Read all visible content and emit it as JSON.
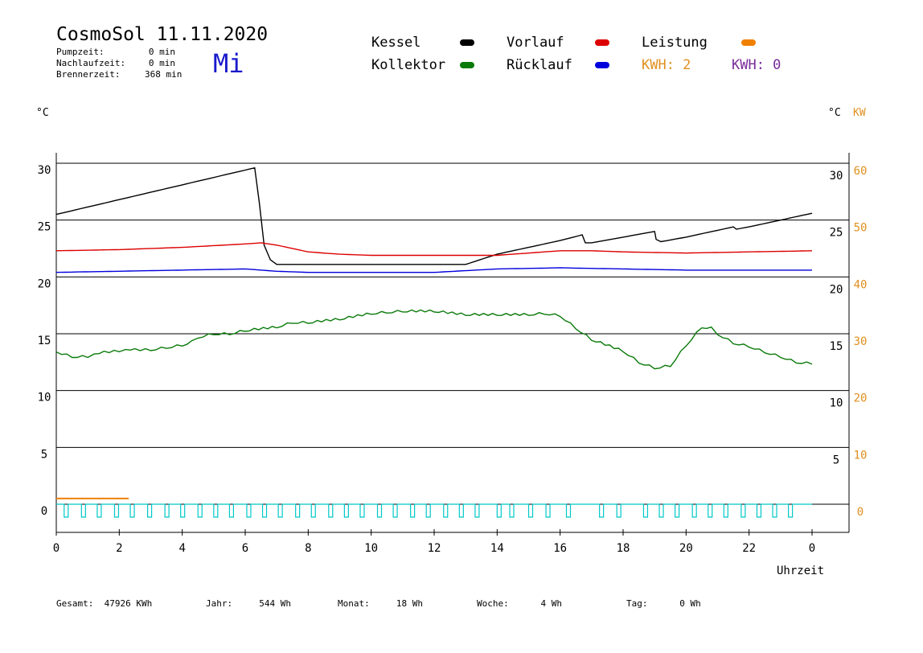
{
  "header": {
    "title": "CosmoSol 11.11.2020",
    "day": "Mi",
    "pumpzeit_label": "Pumpzeit:",
    "pumpzeit_value": "0 min",
    "nachlauf_label": "Nachlaufzeit:",
    "nachlauf_value": "0 min",
    "brenner_label": "Brennerzeit:",
    "brenner_value": "368 min"
  },
  "legend": {
    "kessel": "Kessel",
    "kollektor": "Kollektor",
    "vorlauf": "Vorlauf",
    "ruecklauf": "Rücklauf",
    "leistung": "Leistung",
    "kwh1": "KWH: 2",
    "kwh2": "KWH: 0"
  },
  "colors": {
    "kessel": "#000000",
    "kollektor": "#0a7a0a",
    "vorlauf": "#dd0000",
    "ruecklauf": "#0000dd",
    "leistung": "#f08000",
    "kwh1": "#e09020",
    "kwh2": "#7a2a9a",
    "pumpe": "#00c8c8"
  },
  "axes": {
    "left_unit": "°C",
    "right_unit": "°C",
    "right_unit2": "KW",
    "xlabel": "Uhrzeit"
  },
  "footer": {
    "gesamt_label": "Gesamt:",
    "gesamt_value": "47926 KWh",
    "jahr_label": "Jahr:",
    "jahr_value": "544 Wh",
    "monat_label": "Monat:",
    "monat_value": "18 Wh",
    "woche_label": "Woche:",
    "woche_value": "4 Wh",
    "tag_label": "Tag:",
    "tag_value": "0 Wh"
  },
  "chart_data": {
    "type": "line",
    "xlabel": "Uhrzeit",
    "xlim": [
      0,
      24
    ],
    "ylim": [
      -1,
      30
    ],
    "ylim_kw": [
      0,
      60
    ],
    "x_ticks": [
      "0",
      "2",
      "4",
      "6",
      "8",
      "10",
      "12",
      "14",
      "16",
      "18",
      "20",
      "22",
      "0"
    ],
    "y_ticks_left": [
      "30",
      "25",
      "20",
      "15",
      "10",
      "5",
      "0"
    ],
    "y_ticks_right": [
      "30",
      "25",
      "20",
      "15",
      "10",
      "5"
    ],
    "y_ticks_kw": [
      "60",
      "50",
      "40",
      "30",
      "20",
      "10",
      "0"
    ],
    "gridlines_y": [
      0,
      5,
      10,
      15,
      20,
      25,
      30
    ],
    "series": [
      {
        "name": "Kessel",
        "color_key": "kessel",
        "x": [
          0,
          2,
          4,
          6,
          6.3,
          6.45,
          6.6,
          6.8,
          7.0,
          13.0,
          14.0,
          15.0,
          16.0,
          16.7,
          16.8,
          17.0,
          18.0,
          19.0,
          19.05,
          19.2,
          20.0,
          21.0,
          21.5,
          21.6,
          22.0,
          23.0,
          24.0
        ],
        "y": [
          25.5,
          26.8,
          28.1,
          29.4,
          29.6,
          26.5,
          22.8,
          21.5,
          21.1,
          21.1,
          22.0,
          22.6,
          23.2,
          23.7,
          23.0,
          23.0,
          23.5,
          24.0,
          23.3,
          23.1,
          23.5,
          24.1,
          24.4,
          24.2,
          24.4,
          25.0,
          25.6
        ]
      },
      {
        "name": "Vorlauf",
        "color_key": "vorlauf",
        "x": [
          0,
          2,
          4,
          6,
          6.5,
          7.0,
          8.0,
          9.0,
          10.0,
          12.0,
          14.0,
          16.0,
          17.0,
          18.0,
          20.0,
          22.0,
          24.0
        ],
        "y": [
          22.3,
          22.4,
          22.6,
          22.9,
          23.0,
          22.8,
          22.2,
          22.0,
          21.9,
          21.9,
          21.9,
          22.3,
          22.3,
          22.2,
          22.1,
          22.2,
          22.3
        ]
      },
      {
        "name": "Rücklauf",
        "color_key": "ruecklauf",
        "x": [
          0,
          2,
          4,
          6,
          7,
          8,
          10,
          12,
          14,
          16,
          18,
          20,
          22,
          24
        ],
        "y": [
          20.4,
          20.5,
          20.6,
          20.7,
          20.5,
          20.4,
          20.4,
          20.4,
          20.7,
          20.8,
          20.7,
          20.6,
          20.6,
          20.6
        ]
      },
      {
        "name": "Kollektor",
        "color_key": "kollektor",
        "x": [
          0,
          0.5,
          1.0,
          1.2,
          2.0,
          2.2,
          2.5,
          3.0,
          3.5,
          4.0,
          4.3,
          4.5,
          5.0,
          5.5,
          6.0,
          7.0,
          7.5,
          8.0,
          9.0,
          10.0,
          10.5,
          11.0,
          12.0,
          13.0,
          14.0,
          15.0,
          15.5,
          16.0,
          16.5,
          17.0,
          18.0,
          18.5,
          19.0,
          19.5,
          20.0,
          20.5,
          20.8,
          21.0,
          21.5,
          22.0,
          22.5,
          23.0,
          23.5,
          24.0
        ],
        "y": [
          13.4,
          13.0,
          13.0,
          13.3,
          13.5,
          13.7,
          13.6,
          13.6,
          13.8,
          14.0,
          14.3,
          14.7,
          15.0,
          15.0,
          15.3,
          15.6,
          16.0,
          16.0,
          16.3,
          16.8,
          16.9,
          17.0,
          17.0,
          16.7,
          16.7,
          16.7,
          16.8,
          16.6,
          15.5,
          14.5,
          13.5,
          12.5,
          12.0,
          12.2,
          14.0,
          15.6,
          15.5,
          15.0,
          14.2,
          13.9,
          13.4,
          13.0,
          12.5,
          12.4
        ]
      },
      {
        "name": "Leistung",
        "color_key": "leistung",
        "x": [
          0,
          2.3
        ],
        "y": [
          0.5,
          0.5
        ]
      }
    ],
    "pump_cycles": {
      "color_key": "pumpe",
      "start_hours": [
        0.25,
        0.8,
        1.3,
        1.85,
        2.35,
        2.9,
        3.45,
        3.95,
        4.5,
        5.0,
        5.5,
        6.05,
        6.55,
        7.05,
        7.6,
        8.1,
        8.65,
        9.15,
        9.65,
        10.2,
        10.7,
        11.25,
        11.75,
        12.3,
        12.8,
        13.3,
        14.0,
        14.4,
        15.0,
        15.55,
        16.2,
        17.25,
        17.8,
        18.65,
        19.15,
        19.65,
        20.2,
        20.7,
        21.2,
        21.75,
        22.25,
        22.75,
        23.25
      ],
      "low": -0.4,
      "high": 0
    }
  }
}
